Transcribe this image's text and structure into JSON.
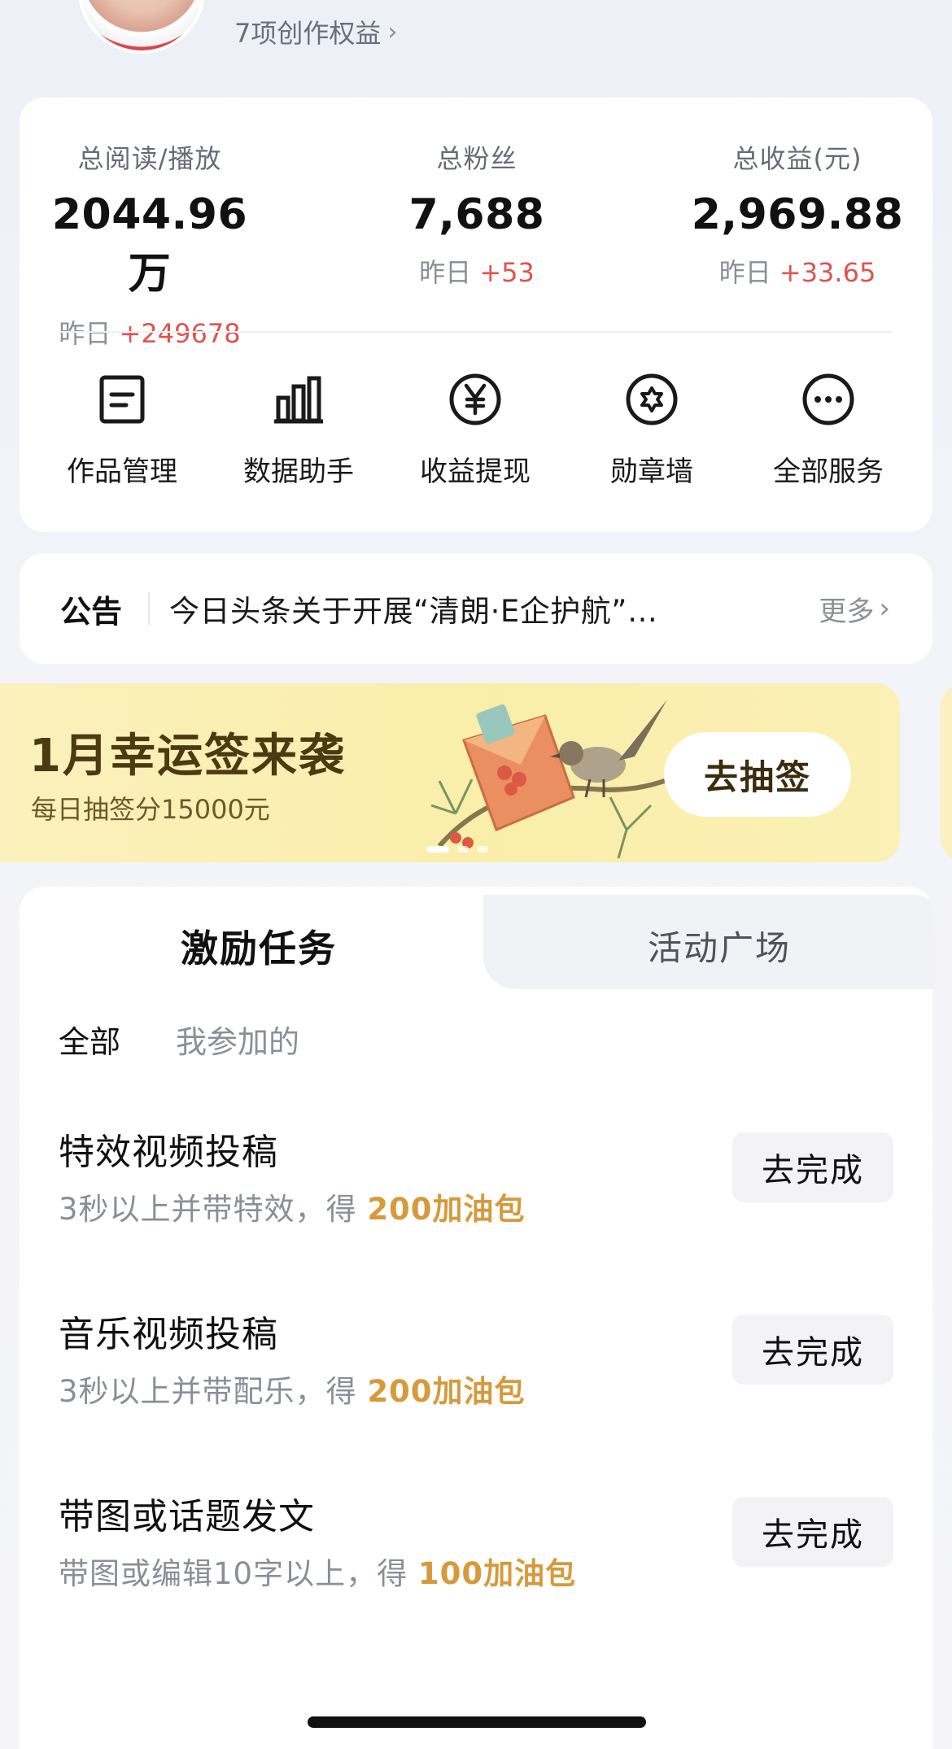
{
  "profile": {
    "rights_link": "7项创作权益",
    "chevron": "›"
  },
  "stats": [
    {
      "label": "总阅读/播放",
      "value": "2044.96万",
      "delta_prefix": "昨日 ",
      "delta": "+249678"
    },
    {
      "label": "总粉丝",
      "value": "7,688",
      "delta_prefix": "昨日 ",
      "delta": "+53"
    },
    {
      "label": "总收益(元)",
      "value": "2,969.88",
      "delta_prefix": "昨日 ",
      "delta": "+33.65"
    }
  ],
  "services": [
    {
      "label": "作品管理",
      "icon": "document-icon"
    },
    {
      "label": "数据助手",
      "icon": "bar-chart-icon"
    },
    {
      "label": "收益提现",
      "icon": "yen-icon"
    },
    {
      "label": "勋章墙",
      "icon": "medal-icon"
    },
    {
      "label": "全部服务",
      "icon": "more-icon"
    }
  ],
  "notice": {
    "title": "公告",
    "text": "今日头条关于开展“清朗·E企护航”…",
    "more": "更多"
  },
  "banner": {
    "title": "1月幸运签来袭",
    "subtitle": "每日抽签分15000元",
    "button": "去抽签"
  },
  "tasks": {
    "tabs": [
      "激励任务",
      "活动广场"
    ],
    "filters": [
      "全部",
      "我参加的"
    ],
    "items": [
      {
        "title": "特效视频投稿",
        "desc": "3秒以上并带特效，得 ",
        "reward": "200加油包",
        "button": "去完成"
      },
      {
        "title": "音乐视频投稿",
        "desc": "3秒以上并带配乐，得 ",
        "reward": "200加油包",
        "button": "去完成"
      },
      {
        "title": "带图或话题发文",
        "desc": "带图或编辑10字以上，得 ",
        "reward": "100加油包",
        "button": "去完成"
      }
    ]
  },
  "colors": {
    "accent_red": "#e0524f",
    "reward_gold": "#d69a3c",
    "banner_bg": "#f9eea9"
  }
}
